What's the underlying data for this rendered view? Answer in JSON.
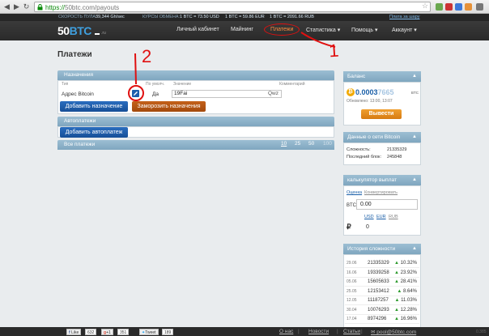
{
  "browser": {
    "url_https": "https://",
    "url_rest": "50btc.com/payouts"
  },
  "infobar": {
    "speed_label": "СКОРОСТЬ ПУЛА:",
    "speed_value": "39,344 Gh/sec",
    "rates_label": "КУРСЫ ОБМЕНА:",
    "rate_usd": "1 BTC = 73.50 USD",
    "rate_eur": "1 BTC = 59.86 EUR",
    "rate_rub": "1 BTC = 2091.66 RUB",
    "pay_link": "Плата за шару"
  },
  "header": {
    "logo_num": "50",
    "logo_btc": "BTC",
    "logo_sub": ".ru",
    "menu": [
      {
        "label": "Личный кабинет"
      },
      {
        "label": "Майнинг"
      },
      {
        "label": "Платежи"
      },
      {
        "label": "Статистика ▾"
      },
      {
        "label": "Помощь ▾"
      },
      {
        "label": "Аккаунт ▾"
      }
    ]
  },
  "page": {
    "title": "Платежи"
  },
  "destinations": {
    "header": "Назначения",
    "col_type": "Тип",
    "col_default": "По умолч.",
    "col_value": "Значение",
    "col_comment": "Комментарий",
    "row_type": "Адрес Bitcoin",
    "row_default": "Да",
    "row_value": "19Fai",
    "row_suffix": "Qwz",
    "add_button": "Добавить назначение",
    "freeze_button": "Заморозить назначения"
  },
  "autopay": {
    "header": "Автоплатежи",
    "add_button": "Добавить автоплатеж"
  },
  "all_payments": {
    "header": "Все платежи",
    "pages": [
      "10",
      "25",
      "50",
      "100"
    ]
  },
  "balance": {
    "header": "Баланс",
    "value_main": "0.0003",
    "value_tail": "7665",
    "unit": "BTC",
    "updated": "Обновлено: 13:00, 13:07",
    "withdraw_button": "Вывести"
  },
  "network": {
    "header": "Данные о сети Bitcoin",
    "difficulty_label": "Сложность:",
    "difficulty_value": "21335329",
    "last_block_label": "Последний блок:",
    "last_block_value": "245848"
  },
  "calculator": {
    "header": "калькулятор выплат",
    "tab_estimate": "Оценка",
    "tab_convert": "Конвертировать",
    "input_label": "BTC:",
    "input_value": "0.00",
    "cur_usd": "USD",
    "cur_eur": "EUR",
    "cur_rub": "RUB",
    "rub_sign": "₽",
    "rub_value": "0"
  },
  "difficulty_history": {
    "header": "История сложности",
    "rows": [
      {
        "date": "29.06",
        "value": "21335329",
        "change": "10.32%"
      },
      {
        "date": "16.06",
        "value": "19339258",
        "change": "23.92%"
      },
      {
        "date": "05.06",
        "value": "15605633",
        "change": "28.41%"
      },
      {
        "date": "25.05",
        "value": "12153412",
        "change": "8.64%"
      },
      {
        "date": "12.05",
        "value": "11187257",
        "change": "11.03%"
      },
      {
        "date": "30.04",
        "value": "10076293",
        "change": "12.28%"
      },
      {
        "date": "17.04",
        "value": "8974296",
        "change": "16.96%"
      }
    ]
  },
  "footer": {
    "like_label": "Like",
    "like_count": "632",
    "plus_label": "+1",
    "plus_count": "351",
    "tweet_label": "Tweet",
    "tweet_count": "189",
    "about": "О нас",
    "news": "Новости",
    "articles": "Статьи",
    "email": "pool@50btc.com",
    "version": "0.385"
  },
  "annotations": {
    "mark_1": "1",
    "mark_2": "2"
  },
  "colors": {
    "accent_blue": "#1c5fae",
    "panel_head": "#8fb3ca",
    "orange": "#b3531a",
    "active_menu": "#ff8a3d",
    "annotation_red": "#e01010"
  }
}
